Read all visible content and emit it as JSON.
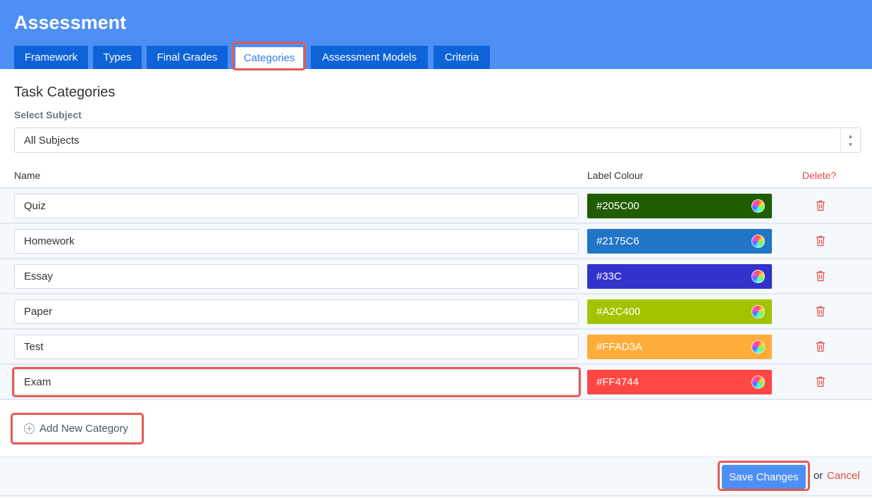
{
  "header": {
    "title": "Assessment",
    "tabs": [
      {
        "label": "Framework"
      },
      {
        "label": "Types"
      },
      {
        "label": "Final Grades"
      },
      {
        "label": "Categories",
        "active": true
      },
      {
        "label": "Assessment Models"
      },
      {
        "label": "Criteria"
      }
    ]
  },
  "main": {
    "title": "Task Categories",
    "select_label": "Select Subject",
    "select_value": "All Subjects",
    "columns": {
      "name": "Name",
      "colour": "Label Colour",
      "delete": "Delete?"
    },
    "categories": [
      {
        "name": "Quiz",
        "colour": "#205C00",
        "swatch": "#205C00"
      },
      {
        "name": "Homework",
        "colour": "#2175C6",
        "swatch": "#2175C6"
      },
      {
        "name": "Essay",
        "colour": "#33C",
        "swatch": "#3333CC"
      },
      {
        "name": "Paper",
        "colour": "#A2C400",
        "swatch": "#A2C400"
      },
      {
        "name": "Test",
        "colour": "#FFAD3A",
        "swatch": "#FFAD3A"
      },
      {
        "name": "Exam",
        "colour": "#FF4744",
        "swatch": "#FF4744"
      }
    ],
    "add_label": "Add New Category"
  },
  "footer": {
    "save_label": "Save Changes",
    "or_text": "or",
    "cancel_label": "Cancel"
  },
  "colors": {
    "header_bg": "#4d8ff5",
    "tab_bg": "#0f63d9",
    "highlight": "#e45a52",
    "delete": "#e24b47"
  },
  "icons": {
    "trash": "trash-icon",
    "add": "plus-circle-icon",
    "picker": "color-wheel-icon"
  }
}
